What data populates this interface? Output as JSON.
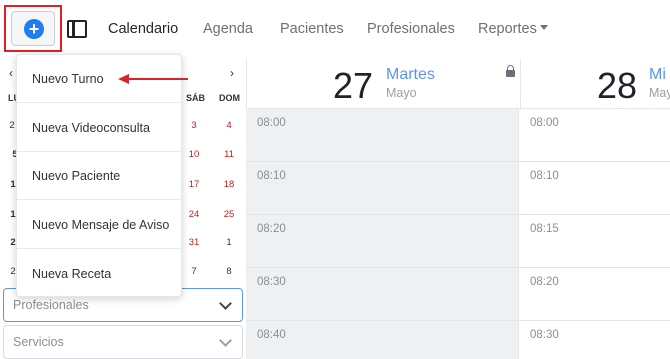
{
  "nav": {
    "add_button": "+",
    "items": [
      {
        "label": "Calendario",
        "active": true
      },
      {
        "label": "Agenda",
        "active": false
      },
      {
        "label": "Pacientes",
        "active": false
      },
      {
        "label": "Profesionales",
        "active": false
      },
      {
        "label": "Reportes",
        "active": false,
        "has_caret": true
      }
    ]
  },
  "mini_calendar": {
    "prev": "‹",
    "next": "›",
    "head_partial": "LU",
    "weekday_headers": [
      "SÁB",
      "DOM"
    ],
    "left_day_column": [
      "2",
      "5",
      "1",
      "1",
      "2",
      "2"
    ],
    "rows": [
      {
        "sat": "3",
        "sun": "4"
      },
      {
        "sat": "10",
        "sun": "11"
      },
      {
        "sat": "17",
        "sun": "18"
      },
      {
        "sat": "24",
        "sun": "25"
      },
      {
        "sat": "31",
        "sun": "1"
      },
      {
        "sat": "7",
        "sun": "8"
      }
    ]
  },
  "dropdown": {
    "items": [
      "Nuevo Turno",
      "Nueva Videoconsulta",
      "Nuevo Paciente",
      "Nuevo Mensaje de Aviso",
      "Nueva Receta"
    ]
  },
  "filters": {
    "profesionales_placeholder": "Profesionales",
    "servicios_placeholder": "Servicios"
  },
  "calendar": {
    "days": [
      {
        "num": "27",
        "name": "Martes",
        "month": "Mayo",
        "locked": true
      },
      {
        "num": "28",
        "name": "Mi",
        "month": "May",
        "locked": false
      }
    ],
    "col1_times": [
      "08:00",
      "08:10",
      "08:20",
      "08:30",
      "08:40"
    ],
    "col2_times": [
      "08:00",
      "08:10",
      "08:15",
      "08:20",
      "08:30"
    ]
  },
  "colors": {
    "accent": "#1f7df1",
    "highlight_border": "#e21f26",
    "weekend_red": "#c21c1c",
    "shaded_column": "#eef0f2"
  }
}
